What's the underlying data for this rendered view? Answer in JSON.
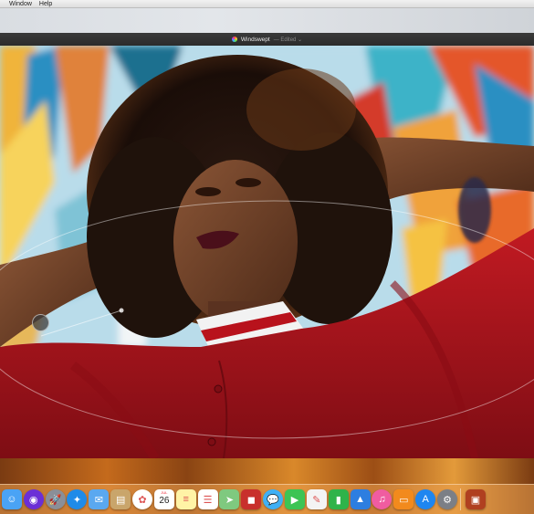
{
  "menubar": {
    "items": [
      "Window",
      "Help"
    ]
  },
  "window": {
    "title": "Windswept",
    "status": "— Edited ⌄",
    "app_icon": "photos-app-icon"
  },
  "dock": {
    "apps": [
      {
        "name": "Finder",
        "icon": "finder-icon",
        "color": "#4aa3f5"
      },
      {
        "name": "Siri",
        "icon": "siri-icon",
        "color": "#6b2fd6"
      },
      {
        "name": "Launchpad",
        "icon": "launchpad-icon",
        "color": "#8a8f98"
      },
      {
        "name": "Safari",
        "icon": "safari-icon",
        "color": "#1f8be8"
      },
      {
        "name": "Mail",
        "icon": "mail-icon",
        "color": "#5aa8f0"
      },
      {
        "name": "Contacts",
        "icon": "contacts-icon",
        "color": "#c9a56b"
      },
      {
        "name": "Photos",
        "icon": "photos-icon",
        "color": "#ffffff"
      },
      {
        "name": "Calendar",
        "icon": "calendar-icon",
        "color": "#ffffff",
        "month": "JUL",
        "day": "26"
      },
      {
        "name": "Notes",
        "icon": "notes-icon",
        "color": "#fff3a6"
      },
      {
        "name": "Reminders",
        "icon": "reminders-icon",
        "color": "#ffffff"
      },
      {
        "name": "Maps",
        "icon": "maps-icon",
        "color": "#7fc97f"
      },
      {
        "name": "Photo Booth",
        "icon": "photo-booth-icon",
        "color": "#c8302c"
      },
      {
        "name": "Messages",
        "icon": "messages-icon",
        "color": "#3fb0f5"
      },
      {
        "name": "FaceTime",
        "icon": "facetime-icon",
        "color": "#3cc454"
      },
      {
        "name": "Pages",
        "icon": "pages-icon",
        "color": "#f4f4f4"
      },
      {
        "name": "Numbers",
        "icon": "numbers-icon",
        "color": "#2fb34a"
      },
      {
        "name": "Keynote",
        "icon": "keynote-icon",
        "color": "#2d7ee0"
      },
      {
        "name": "iTunes",
        "icon": "itunes-icon",
        "color": "#f05ca0"
      },
      {
        "name": "iBooks",
        "icon": "ibooks-icon",
        "color": "#f28a1d"
      },
      {
        "name": "App Store",
        "icon": "app-store-icon",
        "color": "#1e86f0"
      },
      {
        "name": "System Preferences",
        "icon": "system-preferences-icon",
        "color": "#7b7f86"
      }
    ],
    "trailing": [
      {
        "name": "Photo stack",
        "icon": "photo-stack-icon",
        "color": "#b04020"
      }
    ],
    "glyphs": {
      "finder-icon": "☺",
      "siri-icon": "◉",
      "launchpad-icon": "🚀",
      "safari-icon": "✦",
      "mail-icon": "✉",
      "contacts-icon": "▤",
      "photos-icon": "✿",
      "calendar-icon": "",
      "notes-icon": "≡",
      "reminders-icon": "☰",
      "maps-icon": "➤",
      "photo-booth-icon": "◼",
      "messages-icon": "💬",
      "facetime-icon": "▶",
      "pages-icon": "✎",
      "numbers-icon": "▮",
      "keynote-icon": "▲",
      "itunes-icon": "♫",
      "ibooks-icon": "▭",
      "app-store-icon": "A",
      "system-preferences-icon": "⚙",
      "photo-stack-icon": "▣"
    }
  }
}
